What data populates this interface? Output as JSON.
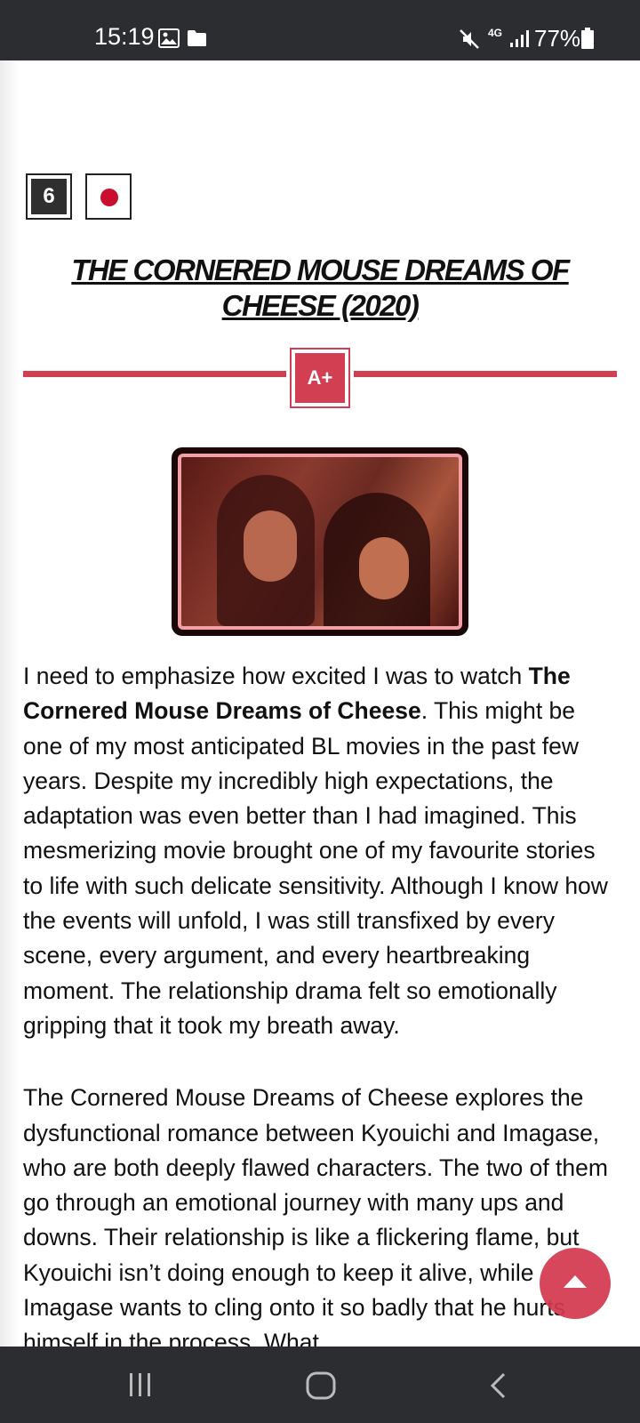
{
  "status_bar": {
    "time": "15:19",
    "network": "4G",
    "battery": "77%",
    "icons": [
      "image-icon",
      "folder-icon",
      "mute-icon",
      "signal-icon",
      "battery-icon"
    ]
  },
  "review": {
    "rank": "6",
    "country_flag": "japan-flag-icon",
    "title": "THE CORNERED MOUSE DREAMS OF CHEESE (2020)",
    "grade": "A+",
    "accent_color": "#d23f53",
    "paragraph1_pre": "I need to emphasize how excited I was to watch ",
    "paragraph1_bold": "The Cornered Mouse Dreams of Cheese",
    "paragraph1_post": ". This might be one of my most anticipated BL movies in the past few years. Despite my incredibly high expectations, the adaptation was even better than I had imagined. This mesmerizing movie brought one of my favourite stories to life with such delicate sensitivity. Although I know how the events will unfold, I was still transfixed by every scene, every argument, and every heartbreaking moment. The relationship drama felt so emotionally gripping that it took my breath away.",
    "paragraph2": "The Cornered Mouse Dreams of Cheese explores the dysfunctional romance between Kyouichi and Imagase, who are both deeply flawed characters. The two of them go through an emotional journey with many ups and downs. Their relationship is like a flickering flame, but Kyouichi isn’t doing enough to keep it alive, while Imagase wants to cling onto it so badly that he hurts himself in the process. What"
  },
  "scroll_top_button": {
    "icon": "arrow-up-icon"
  },
  "nav_bar": {
    "icons": [
      "recent-apps-icon",
      "home-icon",
      "back-icon"
    ]
  }
}
